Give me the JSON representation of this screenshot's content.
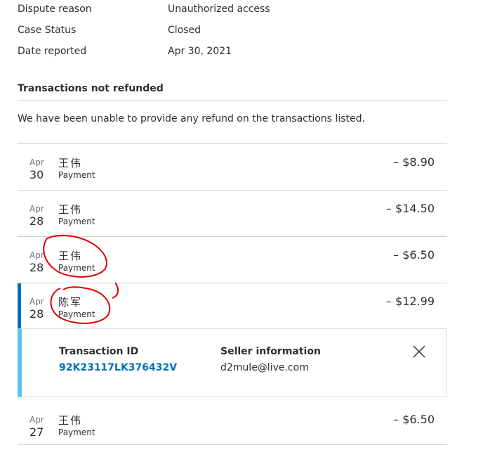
{
  "case_info": [
    {
      "label": "Dispute reason",
      "value": "Unauthorized access"
    },
    {
      "label": "Case Status",
      "value": "Closed"
    },
    {
      "label": "Date reported",
      "value": "Apr 30, 2021"
    }
  ],
  "section": {
    "title": "Transactions not refunded",
    "description": "We have been unable to provide any refund on the transactions listed."
  },
  "transactions": [
    {
      "month": "Apr",
      "day": "30",
      "name": "王伟",
      "type": "Payment",
      "amount": "– $8.90"
    },
    {
      "month": "Apr",
      "day": "28",
      "name": "王伟",
      "type": "Payment",
      "amount": "– $14.50"
    },
    {
      "month": "Apr",
      "day": "28",
      "name": "王伟",
      "type": "Payment",
      "amount": "– $6.50"
    },
    {
      "month": "Apr",
      "day": "28",
      "name": "陈军",
      "type": "Payment",
      "amount": "– $12.99"
    },
    {
      "month": "Apr",
      "day": "27",
      "name": "王伟",
      "type": "Payment",
      "amount": "– $6.50"
    }
  ],
  "detail": {
    "transaction_id_label": "Transaction ID",
    "transaction_id": "92K23117LK376432V",
    "seller_label": "Seller information",
    "seller_email": "d2mule@live.com"
  },
  "colors": {
    "accent": "#0070ba",
    "detail_bar": "#5bc4ee",
    "annotation": "#e00000"
  }
}
